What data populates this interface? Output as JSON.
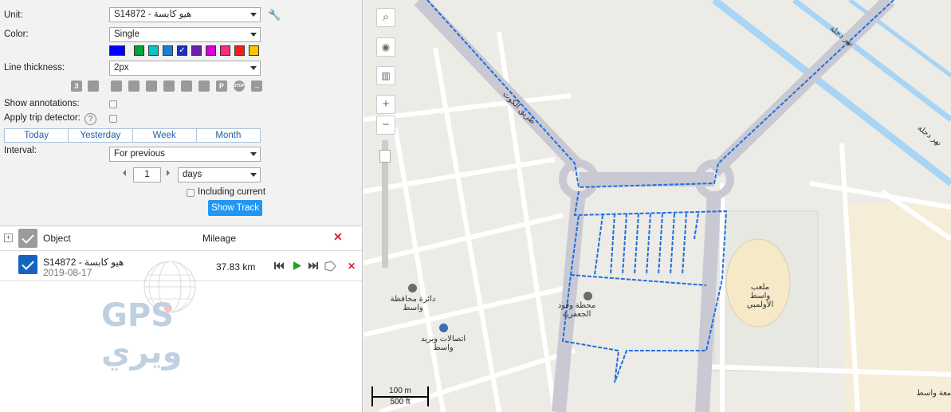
{
  "settings": {
    "unit_label": "Unit:",
    "unit_value": "S14872 - هيو كابسة",
    "color_label": "Color:",
    "color_value": "Single",
    "thickness_label": "Line thickness:",
    "thickness_value": "2px",
    "annotations_label": "Show annotations:",
    "trip_label": "Apply trip detector:",
    "help_glyph": "?",
    "tabs": [
      "Today",
      "Yesterday",
      "Week",
      "Month"
    ],
    "interval_label": "Interval:",
    "interval_value": "For previous",
    "interval_count": "1",
    "interval_unit": "days",
    "including_current": "Including current",
    "show_track": "Show Track",
    "swatch_colors": [
      "#0000ff",
      "#00a33c",
      "#00c7c7",
      "#1b7fd6",
      "#1b2fc4",
      "#6a1fa8",
      "#d600d6",
      "#ff2b7a",
      "#ff1a1a",
      "#ffc400"
    ],
    "marker_icons": [
      "3-icon",
      "flags-icon",
      "fuel-icon",
      "speed-icon",
      "event-icon",
      "flag-icon",
      "image-icon",
      "video-icon",
      "parking-icon",
      "stop-icon",
      "arrow-icon"
    ],
    "marker_glyphs": [
      "3",
      "",
      "",
      "",
      "",
      "",
      "",
      "",
      "P",
      "STOP",
      "→"
    ]
  },
  "list": {
    "object_header": "Object",
    "mileage_header": "Mileage",
    "row": {
      "name": "S14872 - هيو كابسة",
      "date": "2019-08-17",
      "mileage": "37.83 km"
    }
  },
  "map": {
    "labels": [
      "دائرة محافظة واسط",
      "اتصالات وبريد واسط",
      "محطة وقود الجعفرية",
      "ملعب واسط الأولمبي",
      "نهر دجلة",
      "نهر دجلة",
      "طريق الكوت",
      "جامعة واسط"
    ],
    "scale_m": "100 m",
    "scale_ft": "500 ft",
    "track_color": "#1e6fe0"
  },
  "watermark": {
    "text": "GPS ويري"
  }
}
